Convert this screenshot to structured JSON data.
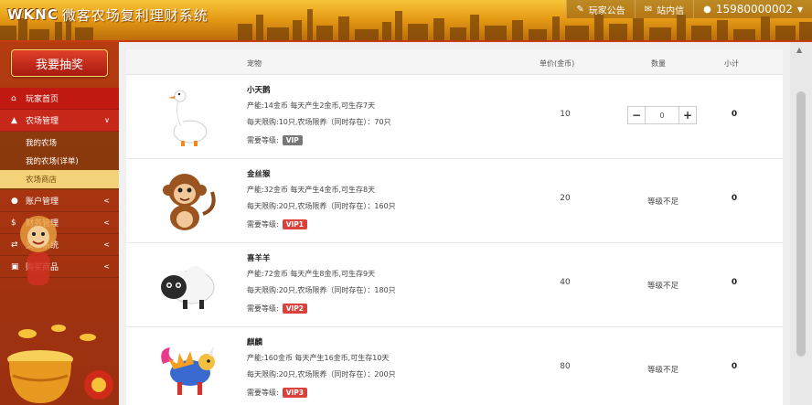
{
  "header": {
    "logo": "WKNC",
    "title": "微客农场复利理财系统",
    "nav": {
      "notice": "玩家公告",
      "messages": "站内信",
      "user": "15980000002"
    }
  },
  "sidebar": {
    "lottery_label": "我要抽奖",
    "menu": [
      {
        "label": "玩家首页"
      },
      {
        "label": "农场管理"
      },
      {
        "label": "账户管理"
      },
      {
        "label": "财务管理"
      },
      {
        "label": "交易系统"
      },
      {
        "label": "购买商品"
      }
    ],
    "submenu": [
      {
        "label": "我的农场"
      },
      {
        "label": "我的农场(详单)"
      },
      {
        "label": "农场商店"
      }
    ]
  },
  "table": {
    "headers": {
      "pet": "宠物",
      "price": "单价(金币)",
      "qty": "数量",
      "subtotal": "小计"
    },
    "level_label": "需要等级:",
    "rows": [
      {
        "name": "小天鹅",
        "line1": "产能:14金币 每天产生2金币,可生存7天",
        "line2": "每天限购:10只,农场限养（同时存在）：70只",
        "level": "VIP",
        "price": "10",
        "qty_value": "0",
        "status": "",
        "subtotal": "0"
      },
      {
        "name": "金丝猴",
        "line1": "产能:32金币 每天产生4金币,可生存8天",
        "line2": "每天限购:20只,农场限养（同时存在）：160只",
        "level": "VIP1",
        "price": "20",
        "qty_value": "",
        "status": "等级不足",
        "subtotal": "0"
      },
      {
        "name": "喜羊羊",
        "line1": "产能:72金币 每天产生8金币,可生存9天",
        "line2": "每天限购:20只,农场限养（同时存在）：180只",
        "level": "VIP2",
        "price": "40",
        "qty_value": "",
        "status": "等级不足",
        "subtotal": "0"
      },
      {
        "name": "麒麟",
        "line1": "产能:160金币 每天产生16金币,可生存10天",
        "line2": "每天限购:20只,农场限养（同时存在）：200只",
        "level": "VIP3",
        "price": "80",
        "qty_value": "",
        "status": "等级不足",
        "subtotal": "0"
      }
    ]
  },
  "colors": {
    "vip_gray": "#777777",
    "vip_red": "#d9413a",
    "sidebar": "#b43c10",
    "header": "#e59a14"
  }
}
